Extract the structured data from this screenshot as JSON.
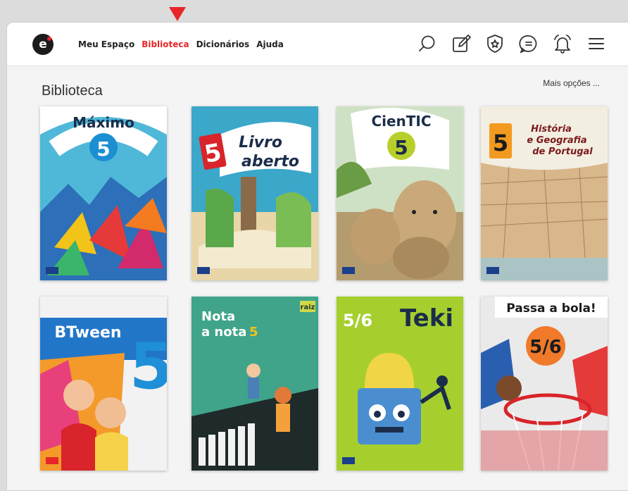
{
  "nav": {
    "logo_text": "e",
    "links": [
      {
        "label": "Meu Espaço"
      },
      {
        "label": "Biblioteca"
      },
      {
        "label": "Dicionários"
      },
      {
        "label": "Ajuda"
      }
    ],
    "active_index": 1,
    "icons": [
      "search-icon",
      "edit-icon",
      "badge-icon",
      "chat-icon",
      "bell-icon",
      "menu-icon"
    ]
  },
  "library": {
    "title": "Biblioteca",
    "more_label": "Mais opções ...",
    "books": [
      {
        "title": "Máximo",
        "grade": "5"
      },
      {
        "title_line1": "Livro",
        "title_line2": "aberto",
        "grade": "5"
      },
      {
        "title": "CienTIC",
        "grade": "5"
      },
      {
        "title_line1": "História",
        "title_line2": "e Geografia",
        "title_line3": "de Portugal",
        "grade": "5"
      },
      {
        "title": "BTween",
        "grade": "5"
      },
      {
        "title_line1": "Nota",
        "title_line2": "a nota",
        "grade": "5",
        "tag": "raiz"
      },
      {
        "title": "Teki",
        "grade": "5/6"
      },
      {
        "title": "Passa a bola!",
        "grade": "5/6"
      }
    ]
  },
  "colors": {
    "accent": "#e8262a",
    "page_bg": "#f4f4f4"
  }
}
